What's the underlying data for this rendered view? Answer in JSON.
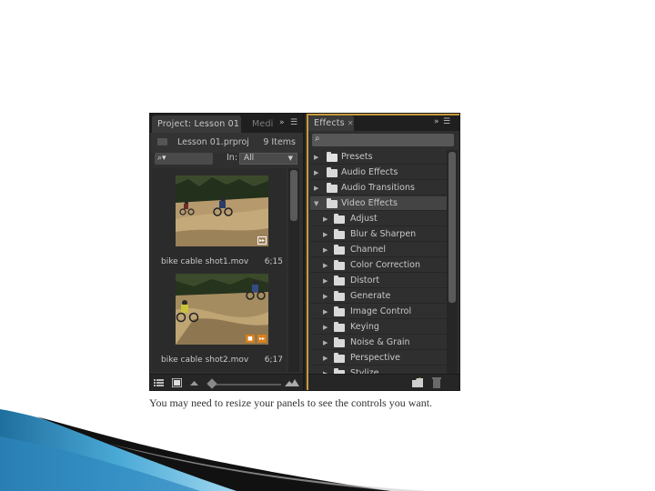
{
  "project_panel": {
    "tab_title": "Project: Lesson 01",
    "second_tab": "Medi",
    "project_file": "Lesson 01.prproj",
    "item_count": "9 Items",
    "in_label": "In:",
    "in_value": "All",
    "clips": [
      {
        "name": "bike cable shot1.mov",
        "duration": "6;15"
      },
      {
        "name": "bike cable shot2.mov",
        "duration": "6;17"
      }
    ]
  },
  "effects_panel": {
    "tab_title": "Effects",
    "items": [
      {
        "label": "Presets",
        "level": 0,
        "expanded": false,
        "icon": "preset-folder-icon"
      },
      {
        "label": "Audio Effects",
        "level": 0,
        "expanded": false,
        "icon": "folder-icon"
      },
      {
        "label": "Audio Transitions",
        "level": 0,
        "expanded": false,
        "icon": "folder-icon"
      },
      {
        "label": "Video Effects",
        "level": 0,
        "expanded": true,
        "icon": "folder-icon"
      },
      {
        "label": "Adjust",
        "level": 1,
        "expanded": false,
        "icon": "folder-icon"
      },
      {
        "label": "Blur & Sharpen",
        "level": 1,
        "expanded": false,
        "icon": "folder-icon"
      },
      {
        "label": "Channel",
        "level": 1,
        "expanded": false,
        "icon": "folder-icon"
      },
      {
        "label": "Color Correction",
        "level": 1,
        "expanded": false,
        "icon": "folder-icon"
      },
      {
        "label": "Distort",
        "level": 1,
        "expanded": false,
        "icon": "folder-icon"
      },
      {
        "label": "Generate",
        "level": 1,
        "expanded": false,
        "icon": "folder-icon"
      },
      {
        "label": "Image Control",
        "level": 1,
        "expanded": false,
        "icon": "folder-icon"
      },
      {
        "label": "Keying",
        "level": 1,
        "expanded": false,
        "icon": "folder-icon"
      },
      {
        "label": "Noise & Grain",
        "level": 1,
        "expanded": false,
        "icon": "folder-icon"
      },
      {
        "label": "Perspective",
        "level": 1,
        "expanded": false,
        "icon": "folder-icon"
      },
      {
        "label": "Stylize",
        "level": 1,
        "expanded": false,
        "icon": "folder-icon"
      }
    ]
  },
  "caption": "You may need to resize your panels to see the controls you want.",
  "colors": {
    "panel_bg": "#2f2f2f",
    "active_border": "#c79a3a",
    "selected_row": "#444444",
    "badge_orange": "#d9801e"
  }
}
